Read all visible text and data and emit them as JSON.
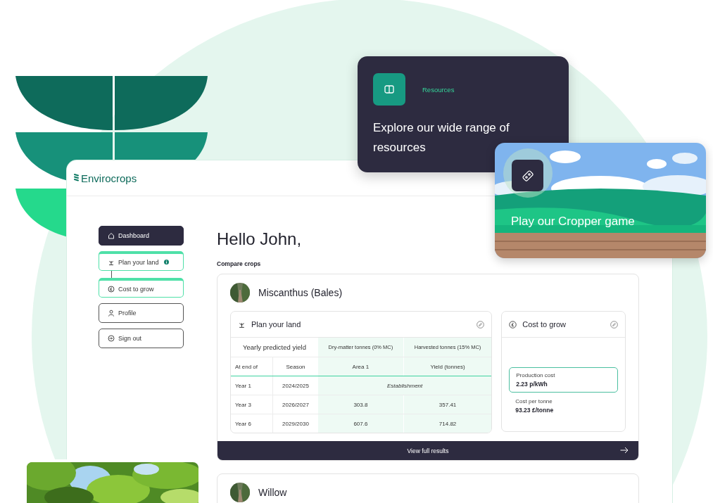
{
  "brand": "Envirocrops",
  "nav": [
    {
      "label": "Dashboard",
      "kind": "dashboard",
      "selected": true,
      "completed": false,
      "info": false
    },
    {
      "label": "Plan your land",
      "kind": "plan",
      "selected": false,
      "completed": true,
      "info": true
    },
    {
      "label": "Cost to grow",
      "kind": "cost",
      "selected": false,
      "completed": true,
      "info": false
    },
    {
      "label": "Profile",
      "kind": "profile",
      "selected": false,
      "completed": false,
      "info": false
    },
    {
      "label": "Sign out",
      "kind": "signout",
      "selected": false,
      "completed": false,
      "info": false
    }
  ],
  "greeting": "Hello John,",
  "compare_label": "Compare crops",
  "crops": [
    {
      "name": "Miscanthus (Bales)",
      "plan": {
        "title": "Plan your land",
        "group_heading": "Yearly predicted yield",
        "measure_headings": [
          "Dry-matter tonnes (0% MC)",
          "Harvested tonnes (15% MC)"
        ],
        "columns": [
          "At end of",
          "Season",
          "Area 1",
          "Yield (tonnes)"
        ],
        "rows": [
          {
            "cells": [
              "Year 1",
              "2024/2025"
            ],
            "note": "Establishment"
          },
          {
            "cells": [
              "Year 3",
              "2026/2027",
              "303.8",
              "357.41"
            ]
          },
          {
            "cells": [
              "Year 6",
              "2029/2030",
              "607.6",
              "714.82"
            ]
          }
        ]
      },
      "cost": {
        "title": "Cost to grow",
        "metrics": [
          {
            "label": "Production cost",
            "value": "2.23 p/kWh",
            "highlighted": true
          },
          {
            "label": "Cost per tonne",
            "value": "93.23 £/tonne",
            "highlighted": false
          }
        ]
      },
      "results_link": "View full results"
    },
    {
      "name": "Willow"
    }
  ],
  "resources_card": {
    "label": "Resources",
    "title": "Explore our wide range of resources"
  },
  "game_card": {
    "title": "Play our Cropper game"
  }
}
